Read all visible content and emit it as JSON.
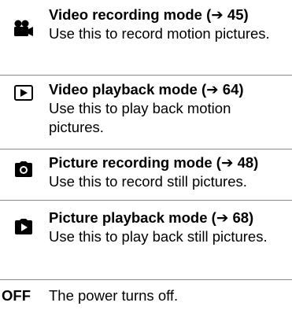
{
  "modes": [
    {
      "icon": "video-camera-icon",
      "title": "Video recording mode (➔ 45)",
      "description": "Use this to record motion pictures."
    },
    {
      "icon": "play-button-icon",
      "title": "Video playback mode (➔ 64)",
      "description": "Use this to play back motion pictures."
    },
    {
      "icon": "camera-icon",
      "title": "Picture recording mode (➔ 48)",
      "description": "Use this to record still pictures."
    },
    {
      "icon": "picture-playback-icon",
      "title": "Picture playback mode (➔ 68)",
      "description": "Use this to play back still pictures."
    }
  ],
  "off": {
    "label": "OFF",
    "description": "The power turns off."
  }
}
